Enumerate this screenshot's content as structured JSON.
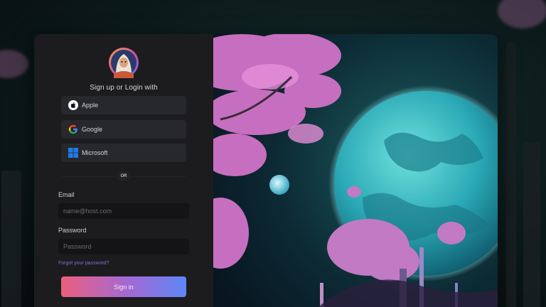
{
  "auth": {
    "heading": "Sign up or Login with",
    "providers": [
      {
        "label": "Apple",
        "icon": "apple-icon"
      },
      {
        "label": "Google",
        "icon": "google-icon"
      },
      {
        "label": "Microsoft",
        "icon": "microsoft-icon"
      }
    ],
    "divider": "OR",
    "email_label": "Email",
    "email_placeholder": "name@host.com",
    "password_label": "Password",
    "password_placeholder": "Password",
    "forgot_link": "Forgot your password?",
    "submit_label": "Sign in"
  },
  "colors": {
    "panel_bg": "#1c1c1e",
    "button_gradient_start": "#ec5e7d",
    "button_gradient_end": "#5e86f7",
    "link": "#7b72d6"
  }
}
